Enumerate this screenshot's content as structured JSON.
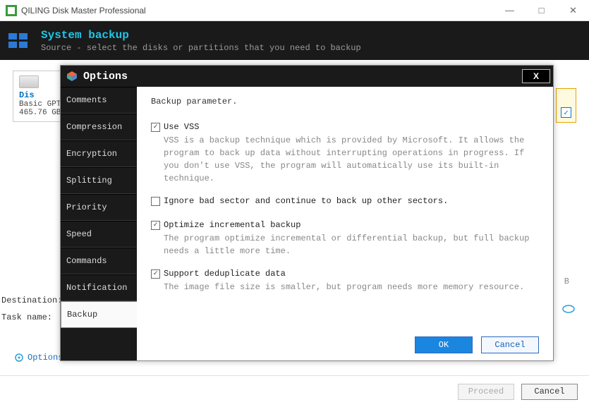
{
  "window": {
    "title": "QILING Disk Master Professional",
    "minimize": "—",
    "maximize": "□",
    "close": "✕"
  },
  "banner": {
    "title": "System backup",
    "subtitle": "Source - select the disks or partitions that you need to backup"
  },
  "disk": {
    "name": "Dis",
    "type": "Basic GPT",
    "size": "465.76 GB"
  },
  "fields": {
    "destination_label": "Destination:",
    "taskname_label": "Task name:",
    "options_label": "Options",
    "hidden_b": "B"
  },
  "footer": {
    "proceed": "Proceed",
    "cancel": "Cancel"
  },
  "modal": {
    "title": "Options",
    "close": "X",
    "sidebar": [
      "Comments",
      "Compression",
      "Encryption",
      "Splitting",
      "Priority",
      "Speed",
      "Commands",
      "Notification",
      "Backup"
    ],
    "active_index": 8,
    "heading": "Backup parameter.",
    "options": {
      "vss": {
        "label": "Use VSS",
        "checked": true,
        "desc": "VSS is a backup technique which is provided by Microsoft. It allows the program to back up data without interrupting operations in progress. If you don't use VSS, the program will automatically use its built-in technique."
      },
      "ignore": {
        "label": "Ignore bad sector and continue to back up other sectors.",
        "checked": false,
        "desc": ""
      },
      "optimize": {
        "label": "Optimize incremental backup",
        "checked": true,
        "desc": "The program optimize incremental or differential backup, but full backup needs a little more time."
      },
      "dedup": {
        "label": "Support deduplicate data",
        "checked": true,
        "desc": "The image file size is smaller, but program needs more memory resource."
      }
    },
    "buttons": {
      "ok": "OK",
      "cancel": "Cancel"
    }
  }
}
